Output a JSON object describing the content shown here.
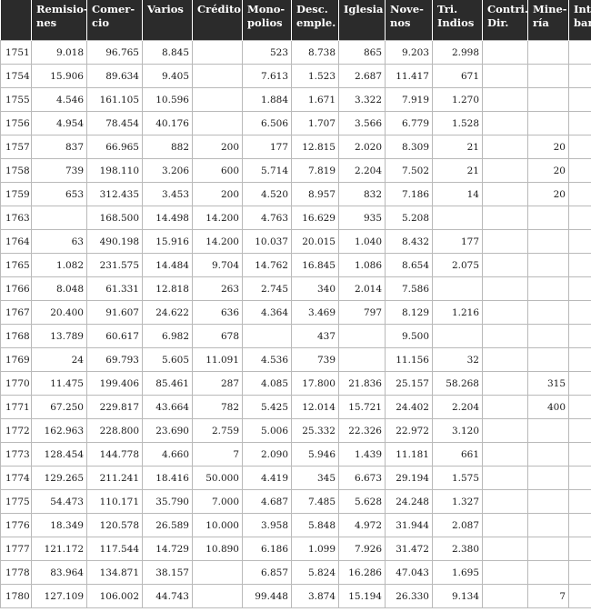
{
  "table": {
    "headers": [
      "",
      "Remisio-\nnes",
      "Comer-\ncio",
      "Varios",
      "Crédito",
      "Mono-\npolios",
      "Desc.\nemple.",
      "Iglesia",
      "Nove-\nnos",
      "Tri.\nIndios",
      "Contri.\nDir.",
      "Mine-\nría",
      "Interés\nbancos"
    ],
    "rows": [
      [
        "1751",
        "9.018",
        "96.765",
        "8.845",
        "",
        "523",
        "8.738",
        "865",
        "9.203",
        "2.998",
        "",
        "",
        ""
      ],
      [
        "1754",
        "15.906",
        "89.634",
        "9.405",
        "",
        "7.613",
        "1.523",
        "2.687",
        "11.417",
        "671",
        "",
        "",
        ""
      ],
      [
        "1755",
        "4.546",
        "161.105",
        "10.596",
        "",
        "1.884",
        "1.671",
        "3.322",
        "7.919",
        "1.270",
        "",
        "",
        ""
      ],
      [
        "1756",
        "4.954",
        "78.454",
        "40.176",
        "",
        "6.506",
        "1.707",
        "3.566",
        "6.779",
        "1.528",
        "",
        "",
        ""
      ],
      [
        "1757",
        "837",
        "66.965",
        "882",
        "200",
        "177",
        "12.815",
        "2.020",
        "8.309",
        "21",
        "",
        "20",
        ""
      ],
      [
        "1758",
        "739",
        "198.110",
        "3.206",
        "600",
        "5.714",
        "7.819",
        "2.204",
        "7.502",
        "21",
        "",
        "20",
        ""
      ],
      [
        "1759",
        "653",
        "312.435",
        "3.453",
        "200",
        "4.520",
        "8.957",
        "832",
        "7.186",
        "14",
        "",
        "20",
        ""
      ],
      [
        "1763",
        "",
        "168.500",
        "14.498",
        "14.200",
        "4.763",
        "16.629",
        "935",
        "5.208",
        "",
        "",
        "",
        ""
      ],
      [
        "1764",
        "63",
        "490.198",
        "15.916",
        "14.200",
        "10.037",
        "20.015",
        "1.040",
        "8.432",
        "177",
        "",
        "",
        ""
      ],
      [
        "1765",
        "1.082",
        "231.575",
        "14.484",
        "9.704",
        "14.762",
        "16.845",
        "1.086",
        "8.654",
        "2.075",
        "",
        "",
        ""
      ],
      [
        "1766",
        "8.048",
        "61.331",
        "12.818",
        "263",
        "2.745",
        "340",
        "2.014",
        "7.586",
        "",
        "",
        "",
        ""
      ],
      [
        "1767",
        "20.400",
        "91.607",
        "24.622",
        "636",
        "4.364",
        "3.469",
        "797",
        "8.129",
        "1.216",
        "",
        "",
        ""
      ],
      [
        "1768",
        "13.789",
        "60.617",
        "6.982",
        "678",
        "",
        "437",
        "",
        "9.500",
        "",
        "",
        "",
        ""
      ],
      [
        "1769",
        "24",
        "69.793",
        "5.605",
        "11.091",
        "4.536",
        "739",
        "",
        "11.156",
        "32",
        "",
        "",
        ""
      ],
      [
        "1770",
        "11.475",
        "199.406",
        "85.461",
        "287",
        "4.085",
        "17.800",
        "21.836",
        "25.157",
        "58.268",
        "",
        "315",
        ""
      ],
      [
        "1771",
        "67.250",
        "229.817",
        "43.664",
        "782",
        "5.425",
        "12.014",
        "15.721",
        "24.402",
        "2.204",
        "",
        "400",
        ""
      ],
      [
        "1772",
        "162.963",
        "228.800",
        "23.690",
        "2.759",
        "5.006",
        "25.332",
        "22.326",
        "22.972",
        "3.120",
        "",
        "",
        ""
      ],
      [
        "1773",
        "128.454",
        "144.778",
        "4.660",
        "7",
        "2.090",
        "5.946",
        "1.439",
        "11.181",
        "661",
        "",
        "",
        ""
      ],
      [
        "1774",
        "129.265",
        "211.241",
        "18.416",
        "50.000",
        "4.419",
        "345",
        "6.673",
        "29.194",
        "1.575",
        "",
        "",
        ""
      ],
      [
        "1775",
        "54.473",
        "110.171",
        "35.790",
        "7.000",
        "4.687",
        "7.485",
        "5.628",
        "24.248",
        "1.327",
        "",
        "",
        ""
      ],
      [
        "1776",
        "18.349",
        "120.578",
        "26.589",
        "10.000",
        "3.958",
        "5.848",
        "4.972",
        "31.944",
        "2.087",
        "",
        "",
        ""
      ],
      [
        "1777",
        "121.172",
        "117.544",
        "14.729",
        "10.890",
        "6.186",
        "1.099",
        "7.926",
        "31.472",
        "2.380",
        "",
        "",
        ""
      ],
      [
        "1778",
        "83.964",
        "134.871",
        "38.157",
        "",
        "6.857",
        "5.824",
        "16.286",
        "47.043",
        "1.695",
        "",
        "",
        ""
      ],
      [
        "1780",
        "127.109",
        "106.002",
        "44.743",
        "",
        "99.448",
        "3.874",
        "15.194",
        "26.330",
        "9.134",
        "",
        "7",
        ""
      ]
    ]
  },
  "colors": {
    "header_bg": "#2b2b2b",
    "header_text": "#ffffff",
    "grid": "#b9b9b9"
  }
}
